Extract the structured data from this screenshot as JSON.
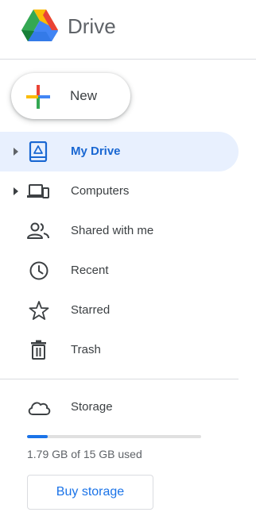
{
  "app": {
    "name": "Drive",
    "logo_icon": "google-drive-logo"
  },
  "new_button": {
    "label": "New",
    "icon": "plus-icon",
    "colors": [
      "#ea4335",
      "#fbbc04",
      "#34a853",
      "#4285f4"
    ]
  },
  "nav": {
    "items": [
      {
        "label": "My Drive",
        "icon": "my-drive-icon",
        "expandable": true,
        "active": true
      },
      {
        "label": "Computers",
        "icon": "computers-icon",
        "expandable": true,
        "active": false
      },
      {
        "label": "Shared with me",
        "icon": "shared-people-icon",
        "expandable": false,
        "active": false
      },
      {
        "label": "Recent",
        "icon": "clock-icon",
        "expandable": false,
        "active": false
      },
      {
        "label": "Starred",
        "icon": "star-icon",
        "expandable": false,
        "active": false
      },
      {
        "label": "Trash",
        "icon": "trash-icon",
        "expandable": false,
        "active": false
      }
    ]
  },
  "storage": {
    "label": "Storage",
    "icon": "cloud-icon",
    "used_fraction": 0.119,
    "usage_text": "1.79 GB of 15 GB used",
    "buy_label": "Buy storage"
  },
  "colors": {
    "accent": "#1a73e8",
    "active_bg": "#e8f0fe",
    "active_text": "#1967d2"
  }
}
